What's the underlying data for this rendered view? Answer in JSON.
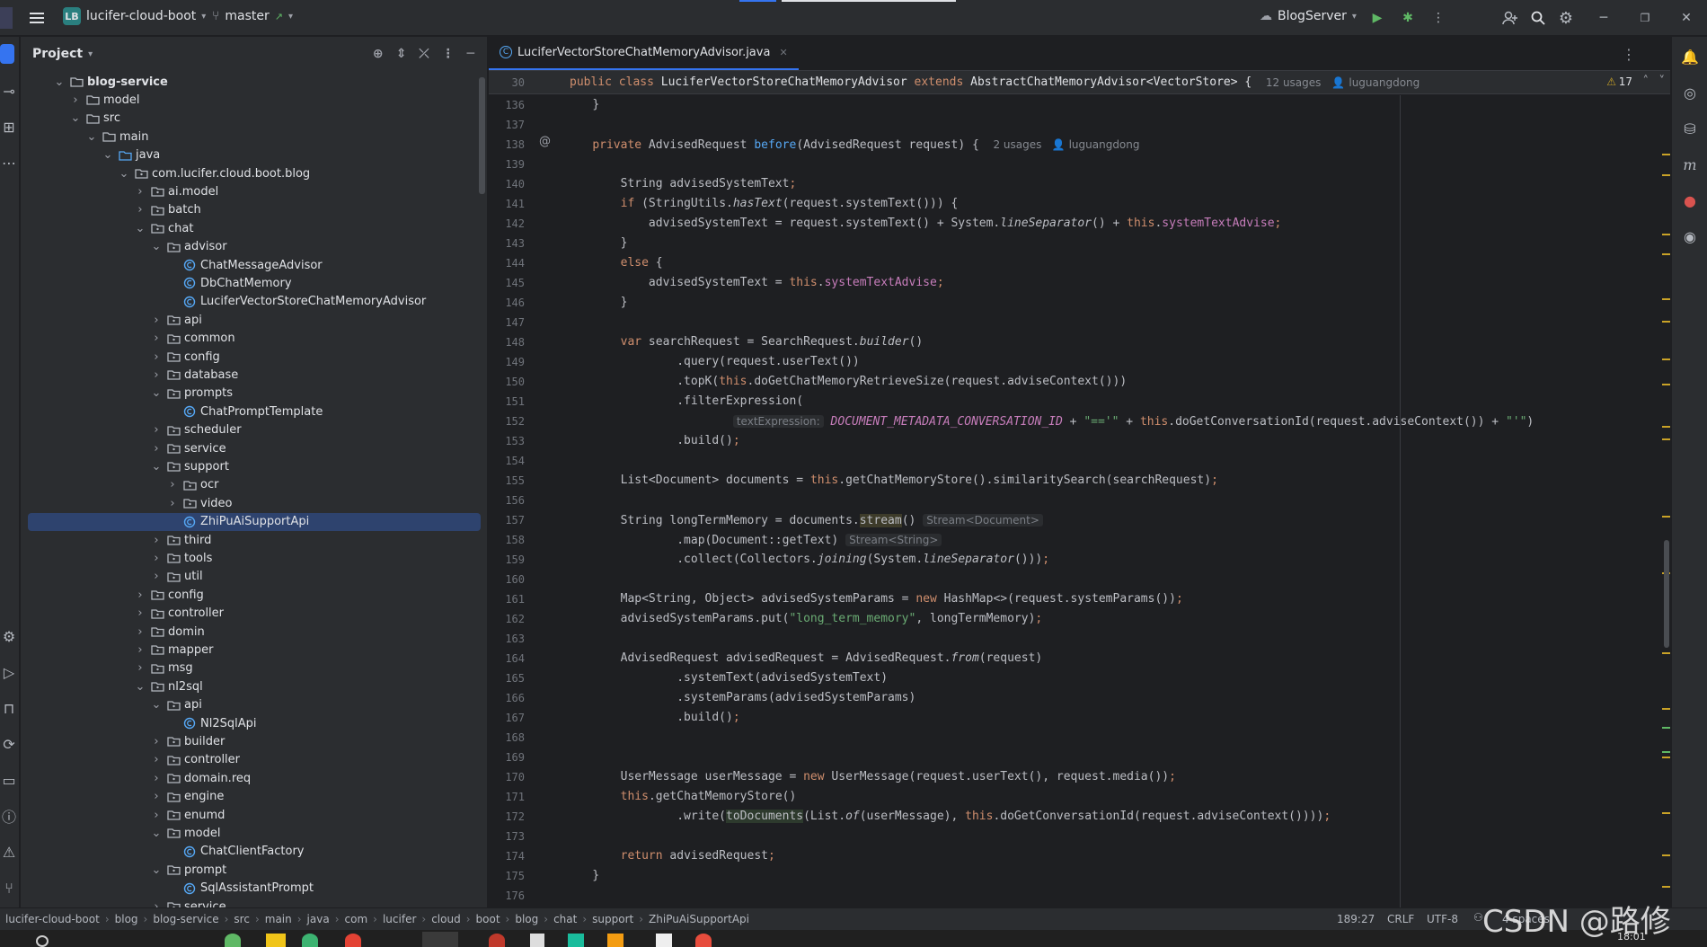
{
  "titlebar": {
    "project_badge": "LB",
    "project_name": "lucifer-cloud-boot",
    "branch": "master",
    "run_config": "BlogServer"
  },
  "project_panel": {
    "title": "Project",
    "tree": [
      {
        "label": "blog-service",
        "depth": 0,
        "type": "module",
        "open": true,
        "bold": true
      },
      {
        "label": "model",
        "depth": 1,
        "type": "folder",
        "open": false
      },
      {
        "label": "src",
        "depth": 1,
        "type": "folder",
        "open": true
      },
      {
        "label": "main",
        "depth": 2,
        "type": "folder",
        "open": true
      },
      {
        "label": "java",
        "depth": 3,
        "type": "srcfolder",
        "open": true
      },
      {
        "label": "com.lucifer.cloud.boot.blog",
        "depth": 4,
        "type": "package",
        "open": true
      },
      {
        "label": "ai.model",
        "depth": 5,
        "type": "package",
        "open": false
      },
      {
        "label": "batch",
        "depth": 5,
        "type": "package",
        "open": false
      },
      {
        "label": "chat",
        "depth": 5,
        "type": "package",
        "open": true
      },
      {
        "label": "advisor",
        "depth": 6,
        "type": "package",
        "open": true
      },
      {
        "label": "ChatMessageAdvisor",
        "depth": 7,
        "type": "class"
      },
      {
        "label": "DbChatMemory",
        "depth": 7,
        "type": "class"
      },
      {
        "label": "LuciferVectorStoreChatMemoryAdvisor",
        "depth": 7,
        "type": "class"
      },
      {
        "label": "api",
        "depth": 6,
        "type": "package",
        "open": false
      },
      {
        "label": "common",
        "depth": 6,
        "type": "package",
        "open": false
      },
      {
        "label": "config",
        "depth": 6,
        "type": "package",
        "open": false
      },
      {
        "label": "database",
        "depth": 6,
        "type": "package",
        "open": false
      },
      {
        "label": "prompts",
        "depth": 6,
        "type": "package",
        "open": true
      },
      {
        "label": "ChatPromptTemplate",
        "depth": 7,
        "type": "class"
      },
      {
        "label": "scheduler",
        "depth": 6,
        "type": "package",
        "open": false
      },
      {
        "label": "service",
        "depth": 6,
        "type": "package",
        "open": false
      },
      {
        "label": "support",
        "depth": 6,
        "type": "package",
        "open": true
      },
      {
        "label": "ocr",
        "depth": 7,
        "type": "package",
        "open": false
      },
      {
        "label": "video",
        "depth": 7,
        "type": "package",
        "open": false
      },
      {
        "label": "ZhiPuAiSupportApi",
        "depth": 7,
        "type": "class",
        "selected": true
      },
      {
        "label": "third",
        "depth": 6,
        "type": "package",
        "open": false
      },
      {
        "label": "tools",
        "depth": 6,
        "type": "package",
        "open": false
      },
      {
        "label": "util",
        "depth": 6,
        "type": "package",
        "open": false
      },
      {
        "label": "config",
        "depth": 5,
        "type": "package",
        "open": false
      },
      {
        "label": "controller",
        "depth": 5,
        "type": "package",
        "open": false
      },
      {
        "label": "domin",
        "depth": 5,
        "type": "package",
        "open": false
      },
      {
        "label": "mapper",
        "depth": 5,
        "type": "package",
        "open": false
      },
      {
        "label": "msg",
        "depth": 5,
        "type": "package",
        "open": false
      },
      {
        "label": "nl2sql",
        "depth": 5,
        "type": "package",
        "open": true
      },
      {
        "label": "api",
        "depth": 6,
        "type": "package",
        "open": true
      },
      {
        "label": "Nl2SqlApi",
        "depth": 7,
        "type": "class"
      },
      {
        "label": "builder",
        "depth": 6,
        "type": "package",
        "open": false
      },
      {
        "label": "controller",
        "depth": 6,
        "type": "package",
        "open": false
      },
      {
        "label": "domain.req",
        "depth": 6,
        "type": "package",
        "open": false
      },
      {
        "label": "engine",
        "depth": 6,
        "type": "package",
        "open": false
      },
      {
        "label": "enumd",
        "depth": 6,
        "type": "package",
        "open": false
      },
      {
        "label": "model",
        "depth": 6,
        "type": "package",
        "open": true
      },
      {
        "label": "ChatClientFactory",
        "depth": 7,
        "type": "class"
      },
      {
        "label": "prompt",
        "depth": 6,
        "type": "package",
        "open": true
      },
      {
        "label": "SqlAssistantPrompt",
        "depth": 7,
        "type": "class"
      },
      {
        "label": "service",
        "depth": 6,
        "type": "package",
        "open": false
      }
    ]
  },
  "editor": {
    "tab_label": "LuciferVectorStoreChatMemoryAdvisor.java",
    "sticky_line_no": "30",
    "sticky_usages": "12 usages",
    "sticky_author": "luguangdong",
    "warning_count": "17",
    "lines": [
      {
        "n": "136",
        "h": "    <span>}</span>"
      },
      {
        "n": "137",
        "h": ""
      },
      {
        "n": "138",
        "h": "    <span class='kw'>private</span> AdvisedRequest <span class='fn'>before</span>(AdvisedRequest request) {  <span class='inl'>2 usages   👤 luguangdong</span>"
      },
      {
        "n": "139",
        "h": ""
      },
      {
        "n": "140",
        "h": "        String advisedSystemText<span class='kw'>;</span>"
      },
      {
        "n": "141",
        "h": "        <span class='kw'>if</span> (StringUtils.<span class='it'>hasText</span>(request.systemText())) {"
      },
      {
        "n": "142",
        "h": "            advisedSystemText = request.systemText() + System.<span class='it'>lineSeparator</span>() + <span class='kw'>this</span>.<span class='fd'>systemTextAdvise</span><span class='kw'>;</span>"
      },
      {
        "n": "143",
        "h": "        }"
      },
      {
        "n": "144",
        "h": "        <span class='kw'>else</span> {"
      },
      {
        "n": "145",
        "h": "            advisedSystemText = <span class='kw'>this</span>.<span class='fd'>systemTextAdvise</span><span class='kw'>;</span>"
      },
      {
        "n": "146",
        "h": "        }"
      },
      {
        "n": "147",
        "h": ""
      },
      {
        "n": "148",
        "h": "        <span class='kw'>var</span> searchRequest = SearchRequest.<span class='it'>builder</span>()"
      },
      {
        "n": "149",
        "h": "                .query(request.userText())"
      },
      {
        "n": "150",
        "h": "                .topK(<span class='kw'>this</span>.doGetChatMemoryRetrieveSize(request.adviseContext()))"
      },
      {
        "n": "151",
        "h": "                .filterExpression("
      },
      {
        "n": "152",
        "h": "                        <span class='hint'>textExpression:</span> <span class='fd it'>DOCUMENT_METADATA_CONVERSATION_ID</span> + <span class='st'>\"=='\"</span> + <span class='kw'>this</span>.doGetConversationId(request.adviseContext()) + <span class='st'>\"'\"</span>)"
      },
      {
        "n": "153",
        "h": "                .build()<span class='kw'>;</span>"
      },
      {
        "n": "154",
        "h": ""
      },
      {
        "n": "155",
        "h": "        List&lt;Document&gt; documents = <span class='kw'>this</span>.getChatMemoryStore().similaritySearch(searchRequest)<span class='kw'>;</span>"
      },
      {
        "n": "156",
        "h": ""
      },
      {
        "n": "157",
        "h": "        String longTermMemory = documents.<span style='background:#3d3b2a'>stream</span>() <span class='hint'>Stream&lt;Document&gt;</span>"
      },
      {
        "n": "158",
        "h": "                .map(Document::getText) <span class='hint'>Stream&lt;String&gt;</span>"
      },
      {
        "n": "159",
        "h": "                .collect(Collectors.<span class='it'>joining</span>(System.<span class='it'>lineSeparator</span>()))<span class='kw'>;</span>"
      },
      {
        "n": "160",
        "h": ""
      },
      {
        "n": "161",
        "h": "        Map&lt;String, Object&gt; advisedSystemParams = <span class='kw'>new</span> HashMap&lt;&gt;(request.systemParams())<span class='kw'>;</span>"
      },
      {
        "n": "162",
        "h": "        advisedSystemParams.put(<span class='st'>\"long_term_memory\"</span>, longTermMemory)<span class='kw'>;</span>"
      },
      {
        "n": "163",
        "h": ""
      },
      {
        "n": "164",
        "h": "        AdvisedRequest advisedRequest = AdvisedRequest.<span class='it'>from</span>(request)"
      },
      {
        "n": "165",
        "h": "                .systemText(advisedSystemText)"
      },
      {
        "n": "166",
        "h": "                .systemParams(advisedSystemParams)"
      },
      {
        "n": "167",
        "h": "                .build()<span class='kw'>;</span>"
      },
      {
        "n": "168",
        "h": ""
      },
      {
        "n": "169",
        "h": ""
      },
      {
        "n": "170",
        "h": "        UserMessage userMessage = <span class='kw'>new</span> UserMessage(request.userText(), request.media())<span class='kw'>;</span>"
      },
      {
        "n": "171",
        "h": "        <span class='kw'>this</span>.getChatMemoryStore()"
      },
      {
        "n": "172",
        "h": "                .write(<span style='background:#2d3a2d'>toDocuments</span>(List.<span class='it'>of</span>(userMessage), <span class='kw'>this</span>.doGetConversationId(request.adviseContext())))<span class='kw'>;</span>"
      },
      {
        "n": "173",
        "h": ""
      },
      {
        "n": "174",
        "h": "        <span class='kw'>return</span> advisedRequest<span class='kw'>;</span>"
      },
      {
        "n": "175",
        "h": "    }"
      },
      {
        "n": "176",
        "h": ""
      }
    ]
  },
  "statusbar": {
    "breadcrumbs": [
      "lucifer-cloud-boot",
      "blog",
      "blog-service",
      "src",
      "main",
      "java",
      "com",
      "lucifer",
      "cloud",
      "boot",
      "blog",
      "chat",
      "support",
      "ZhiPuAiSupportApi"
    ],
    "position": "189:27",
    "line_sep": "CRLF",
    "encoding": "UTF-8",
    "indent": "4 spaces",
    "time": "18:01"
  },
  "watermark": "CSDN @路修",
  "colors": {
    "accent": "#3574f0",
    "selection": "#2e436e",
    "keyword": "#cf8e6d",
    "string": "#6aab73",
    "field": "#c77dbb",
    "method": "#56a8f5",
    "warning": "#c9a227"
  }
}
